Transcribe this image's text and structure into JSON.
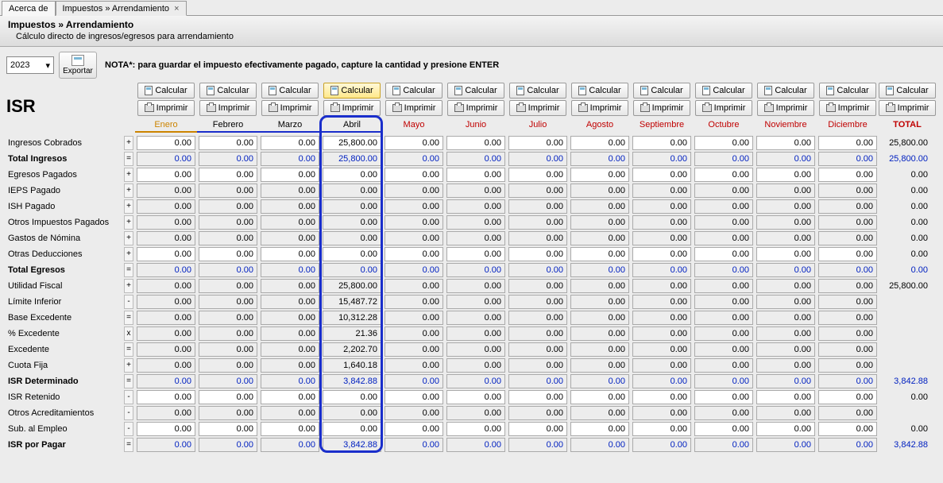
{
  "tabs": [
    {
      "label": "Acerca de"
    },
    {
      "label": "Impuestos » Arrendamiento",
      "active": true,
      "closable": true
    }
  ],
  "titlebar": {
    "breadcrumb": "Impuestos » Arrendamiento",
    "subtitle": "Cálculo directo de ingresos/egresos para arrendamiento"
  },
  "toolbar": {
    "year": "2023",
    "export_label": "Exportar",
    "note_bold": "NOTA*: para guardar el impuesto efectivamente pagado, capture la cantidad y presione ENTER"
  },
  "section_title": "ISR",
  "buttons": {
    "calcular": "Calcular",
    "imprimir": "Imprimir"
  },
  "months": [
    "Enero",
    "Febrero",
    "Marzo",
    "Abril",
    "Mayo",
    "Junio",
    "Julio",
    "Agosto",
    "Septiembre",
    "Octubre",
    "Noviembre",
    "Diciembre"
  ],
  "total_label": "TOTAL",
  "highlight_month_index": 3,
  "rows": [
    {
      "label": "Ingresos Cobrados",
      "op": "+",
      "bold": false,
      "readonly": false,
      "blue": false,
      "values": [
        "0.00",
        "0.00",
        "0.00",
        "25,800.00",
        "0.00",
        "0.00",
        "0.00",
        "0.00",
        "0.00",
        "0.00",
        "0.00",
        "0.00"
      ],
      "total": "25,800.00"
    },
    {
      "label": "Total Ingresos",
      "op": "=",
      "bold": true,
      "readonly": true,
      "blue": true,
      "values": [
        "0.00",
        "0.00",
        "0.00",
        "25,800.00",
        "0.00",
        "0.00",
        "0.00",
        "0.00",
        "0.00",
        "0.00",
        "0.00",
        "0.00"
      ],
      "total": "25,800.00"
    },
    {
      "label": "Egresos Pagados",
      "op": "+",
      "bold": false,
      "readonly": false,
      "blue": false,
      "values": [
        "0.00",
        "0.00",
        "0.00",
        "0.00",
        "0.00",
        "0.00",
        "0.00",
        "0.00",
        "0.00",
        "0.00",
        "0.00",
        "0.00"
      ],
      "total": "0.00"
    },
    {
      "label": "IEPS Pagado",
      "op": "+",
      "bold": false,
      "readonly": true,
      "blue": false,
      "values": [
        "0.00",
        "0.00",
        "0.00",
        "0.00",
        "0.00",
        "0.00",
        "0.00",
        "0.00",
        "0.00",
        "0.00",
        "0.00",
        "0.00"
      ],
      "total": "0.00"
    },
    {
      "label": "ISH Pagado",
      "op": "+",
      "bold": false,
      "readonly": true,
      "blue": false,
      "values": [
        "0.00",
        "0.00",
        "0.00",
        "0.00",
        "0.00",
        "0.00",
        "0.00",
        "0.00",
        "0.00",
        "0.00",
        "0.00",
        "0.00"
      ],
      "total": "0.00"
    },
    {
      "label": "Otros Impuestos Pagados",
      "op": "+",
      "bold": false,
      "readonly": true,
      "blue": false,
      "values": [
        "0.00",
        "0.00",
        "0.00",
        "0.00",
        "0.00",
        "0.00",
        "0.00",
        "0.00",
        "0.00",
        "0.00",
        "0.00",
        "0.00"
      ],
      "total": "0.00"
    },
    {
      "label": "Gastos de Nómina",
      "op": "+",
      "bold": false,
      "readonly": true,
      "blue": false,
      "values": [
        "0.00",
        "0.00",
        "0.00",
        "0.00",
        "0.00",
        "0.00",
        "0.00",
        "0.00",
        "0.00",
        "0.00",
        "0.00",
        "0.00"
      ],
      "total": "0.00"
    },
    {
      "label": "Otras Deducciones",
      "op": "+",
      "bold": false,
      "readonly": false,
      "blue": false,
      "values": [
        "0.00",
        "0.00",
        "0.00",
        "0.00",
        "0.00",
        "0.00",
        "0.00",
        "0.00",
        "0.00",
        "0.00",
        "0.00",
        "0.00"
      ],
      "total": "0.00"
    },
    {
      "label": "Total Egresos",
      "op": "=",
      "bold": true,
      "readonly": true,
      "blue": true,
      "values": [
        "0.00",
        "0.00",
        "0.00",
        "0.00",
        "0.00",
        "0.00",
        "0.00",
        "0.00",
        "0.00",
        "0.00",
        "0.00",
        "0.00"
      ],
      "total": "0.00"
    },
    {
      "label": "Utilidad Fiscal",
      "op": "+",
      "bold": false,
      "readonly": true,
      "blue": false,
      "values": [
        "0.00",
        "0.00",
        "0.00",
        "25,800.00",
        "0.00",
        "0.00",
        "0.00",
        "0.00",
        "0.00",
        "0.00",
        "0.00",
        "0.00"
      ],
      "total": "25,800.00"
    },
    {
      "label": "Límite Inferior",
      "op": "-",
      "bold": false,
      "readonly": true,
      "blue": false,
      "values": [
        "0.00",
        "0.00",
        "0.00",
        "15,487.72",
        "0.00",
        "0.00",
        "0.00",
        "0.00",
        "0.00",
        "0.00",
        "0.00",
        "0.00"
      ],
      "total": ""
    },
    {
      "label": "Base Excedente",
      "op": "=",
      "bold": false,
      "readonly": true,
      "blue": false,
      "values": [
        "0.00",
        "0.00",
        "0.00",
        "10,312.28",
        "0.00",
        "0.00",
        "0.00",
        "0.00",
        "0.00",
        "0.00",
        "0.00",
        "0.00"
      ],
      "total": ""
    },
    {
      "label": "% Excedente",
      "op": "x",
      "bold": false,
      "readonly": true,
      "blue": false,
      "values": [
        "0.00",
        "0.00",
        "0.00",
        "21.36",
        "0.00",
        "0.00",
        "0.00",
        "0.00",
        "0.00",
        "0.00",
        "0.00",
        "0.00"
      ],
      "total": ""
    },
    {
      "label": "Excedente",
      "op": "=",
      "bold": false,
      "readonly": true,
      "blue": false,
      "values": [
        "0.00",
        "0.00",
        "0.00",
        "2,202.70",
        "0.00",
        "0.00",
        "0.00",
        "0.00",
        "0.00",
        "0.00",
        "0.00",
        "0.00"
      ],
      "total": ""
    },
    {
      "label": "Cuota Fija",
      "op": "+",
      "bold": false,
      "readonly": true,
      "blue": false,
      "values": [
        "0.00",
        "0.00",
        "0.00",
        "1,640.18",
        "0.00",
        "0.00",
        "0.00",
        "0.00",
        "0.00",
        "0.00",
        "0.00",
        "0.00"
      ],
      "total": ""
    },
    {
      "label": "ISR Determinado",
      "op": "=",
      "bold": true,
      "readonly": true,
      "blue": true,
      "values": [
        "0.00",
        "0.00",
        "0.00",
        "3,842.88",
        "0.00",
        "0.00",
        "0.00",
        "0.00",
        "0.00",
        "0.00",
        "0.00",
        "0.00"
      ],
      "total": "3,842.88"
    },
    {
      "label": "ISR Retenido",
      "op": "-",
      "bold": false,
      "readonly": false,
      "blue": false,
      "values": [
        "0.00",
        "0.00",
        "0.00",
        "0.00",
        "0.00",
        "0.00",
        "0.00",
        "0.00",
        "0.00",
        "0.00",
        "0.00",
        "0.00"
      ],
      "total": "0.00"
    },
    {
      "label": "Otros Acreditamientos",
      "op": "-",
      "bold": false,
      "readonly": true,
      "blue": false,
      "values": [
        "0.00",
        "0.00",
        "0.00",
        "0.00",
        "0.00",
        "0.00",
        "0.00",
        "0.00",
        "0.00",
        "0.00",
        "0.00",
        "0.00"
      ],
      "total": ""
    },
    {
      "label": "Sub. al Empleo",
      "op": "-",
      "bold": false,
      "readonly": false,
      "blue": false,
      "values": [
        "0.00",
        "0.00",
        "0.00",
        "0.00",
        "0.00",
        "0.00",
        "0.00",
        "0.00",
        "0.00",
        "0.00",
        "0.00",
        "0.00"
      ],
      "total": "0.00"
    },
    {
      "label": "ISR por Pagar",
      "op": "=",
      "bold": true,
      "readonly": true,
      "blue": true,
      "values": [
        "0.00",
        "0.00",
        "0.00",
        "3,842.88",
        "0.00",
        "0.00",
        "0.00",
        "0.00",
        "0.00",
        "0.00",
        "0.00",
        "0.00"
      ],
      "total": "3,842.88"
    }
  ]
}
